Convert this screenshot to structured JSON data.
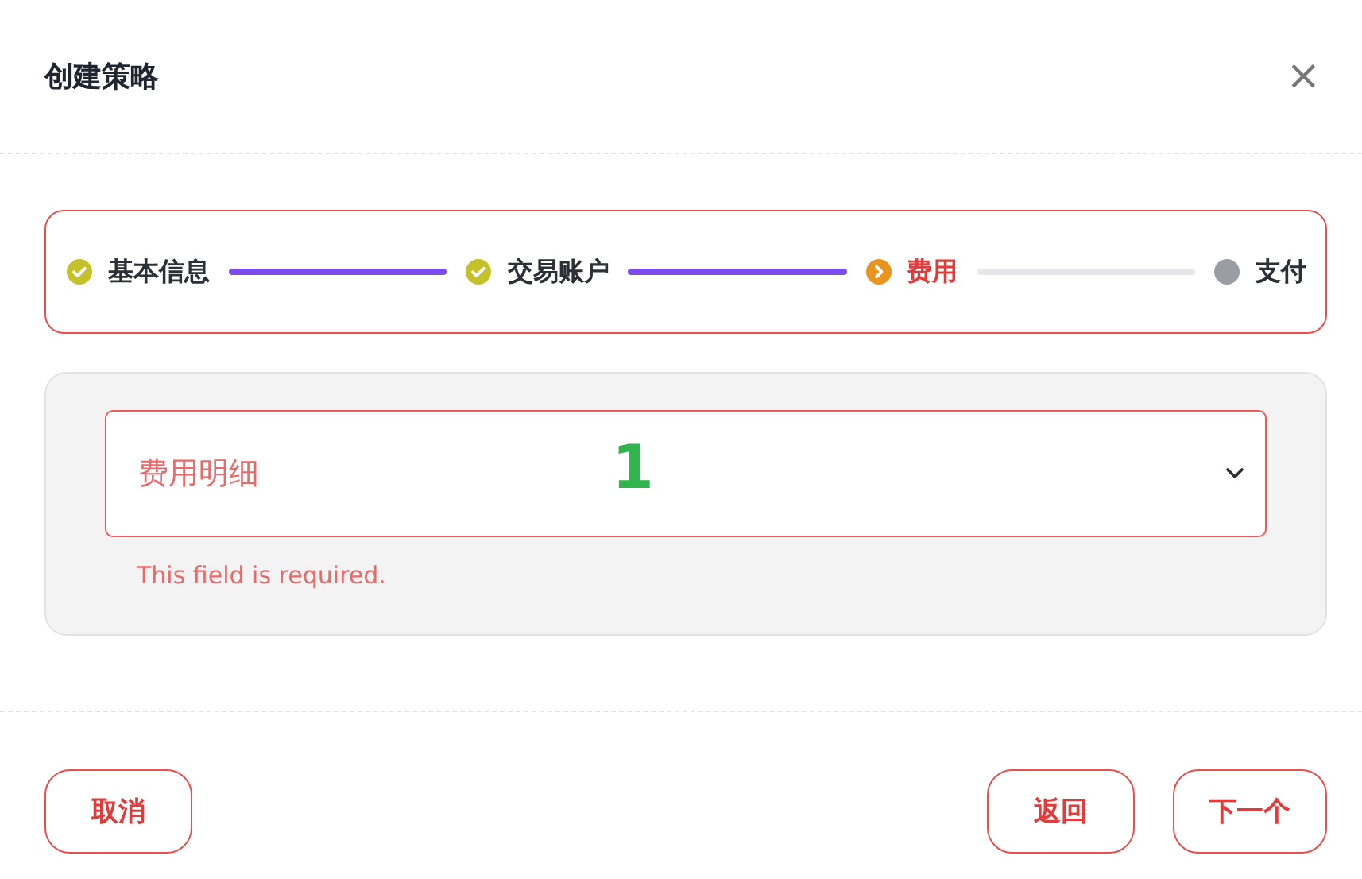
{
  "dialog": {
    "title": "创建策略",
    "close": "×"
  },
  "steps": [
    {
      "label": "基本信息",
      "done": true,
      "selected": false
    },
    {
      "label": "交易账户",
      "done": true,
      "selected": false
    },
    {
      "label": "费用",
      "done": false,
      "selected": true
    },
    {
      "label": "支付",
      "done": false,
      "selected": false
    }
  ],
  "field": {
    "placeholder": "费用明细",
    "invalid": true,
    "error": "This field is required."
  },
  "annotation": {
    "label": "1"
  },
  "buttons": {
    "left": [
      "取消"
    ],
    "right": [
      "返回",
      "下一个"
    ]
  }
}
